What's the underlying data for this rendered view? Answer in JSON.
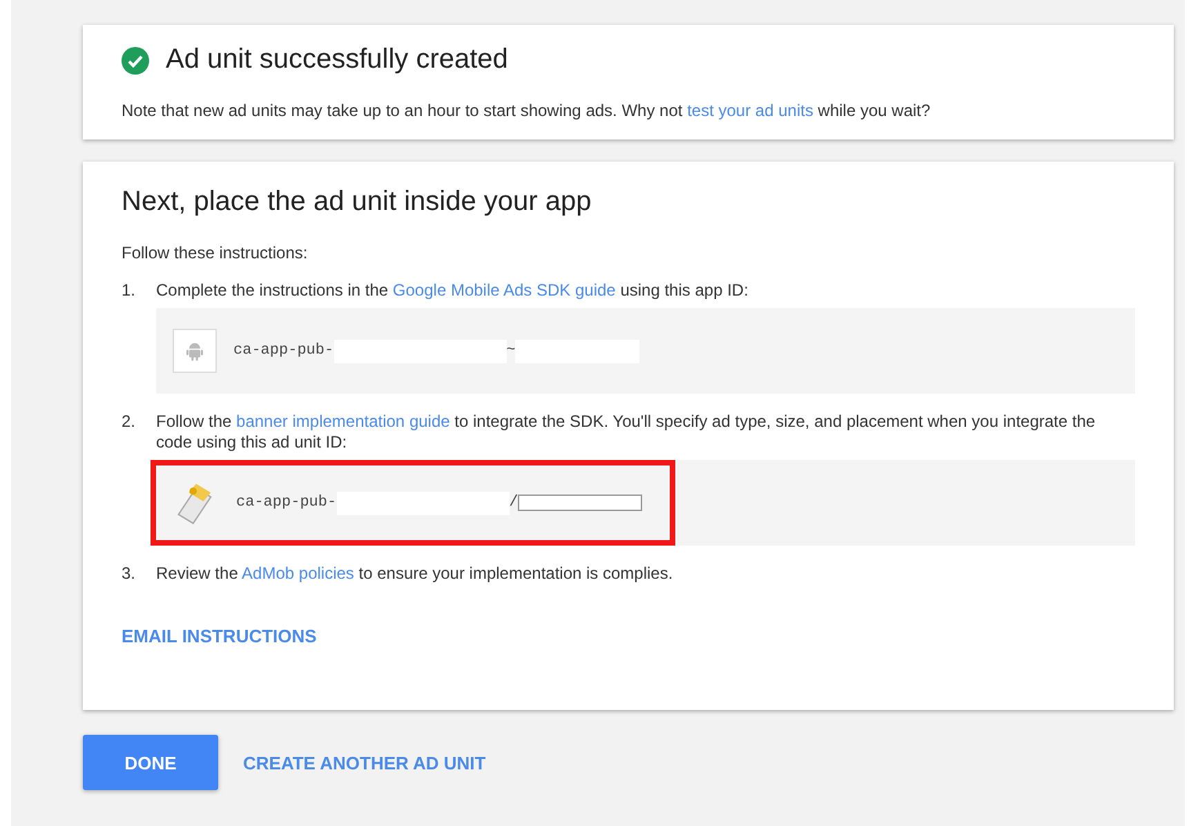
{
  "success_card": {
    "title": "Ad unit successfully created",
    "note": [
      {
        "kind": "text",
        "text": "Note that new ad units may take up to an hour to start showing ads. Why not "
      },
      {
        "kind": "link",
        "text": "test your ad units"
      },
      {
        "kind": "text",
        "text": " while you wait?"
      }
    ]
  },
  "instructions_card": {
    "title": "Next, place the ad unit inside your app",
    "intro": "Follow these instructions:",
    "steps": [
      {
        "number": "1.",
        "text": [
          {
            "kind": "text",
            "text": "Complete the instructions in the "
          },
          {
            "kind": "link",
            "text": "Google Mobile Ads SDK guide"
          },
          {
            "kind": "text",
            "text": " using this app ID:"
          }
        ],
        "id_block": {
          "kind": "android",
          "prefix": "ca-app-pub-",
          "separator": "~",
          "highlighted": false
        }
      },
      {
        "number": "2.",
        "text": [
          {
            "kind": "text",
            "text": "Follow the "
          },
          {
            "kind": "link",
            "text": "banner implementation guide"
          },
          {
            "kind": "text",
            "text": " to integrate the SDK. You'll specify ad type, size, and placement when you integrate the code using this ad unit ID:"
          }
        ],
        "id_block": {
          "kind": "adunit",
          "prefix": "ca-app-pub-",
          "separator": "/",
          "highlighted": true
        }
      },
      {
        "number": "3.",
        "text": [
          {
            "kind": "text",
            "text": "Review the "
          },
          {
            "kind": "link",
            "text": "AdMob policies"
          },
          {
            "kind": "text",
            "text": " to ensure your implementation is complies."
          }
        ]
      }
    ],
    "email_link": "EMAIL INSTRUCTIONS"
  },
  "actions": {
    "primary": "DONE",
    "secondary": "CREATE ANOTHER AD UNIT"
  }
}
